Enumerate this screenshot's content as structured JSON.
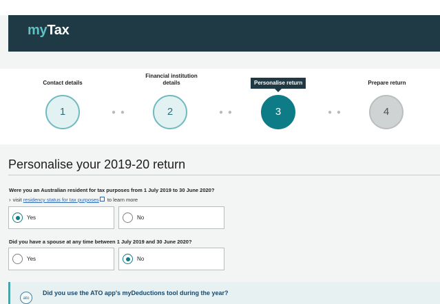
{
  "header": {
    "logo_my": "my",
    "logo_tax": "Tax"
  },
  "steps": [
    {
      "label_line1": "Contact details",
      "label_line2": "",
      "number": "1",
      "state": "done"
    },
    {
      "label_line1": "Financial institution",
      "label_line2": "details",
      "number": "2",
      "state": "done"
    },
    {
      "label_line1": "Personalise return",
      "label_line2": "",
      "number": "3",
      "state": "active"
    },
    {
      "label_line1": "Prepare return",
      "label_line2": "",
      "number": "4",
      "state": "todo"
    }
  ],
  "page_title": "Personalise your 2019-20 return",
  "question1": {
    "label": "Were you an Australian resident for tax purposes from 1 July 2019 to 30 June 2020?",
    "hint_prefix": "visit",
    "hint_link": "residency status for tax purposes",
    "hint_suffix": "to learn more",
    "options": [
      {
        "label": "Yes",
        "selected": true
      },
      {
        "label": "No",
        "selected": false
      }
    ]
  },
  "question2": {
    "label": "Did you have a spouse at any time between 1 July 2019 and 30 June 2020?",
    "options": [
      {
        "label": "Yes",
        "selected": false
      },
      {
        "label": "No",
        "selected": true
      }
    ]
  },
  "banner": {
    "badge": "ato",
    "text": "Did you use the ATO app's myDeductions tool during the year?"
  },
  "colors": {
    "header_bg": "#1f3a44",
    "accent_teal": "#0e7c86",
    "logo_my": "#5fc2c6",
    "link": "#2a67b5"
  }
}
